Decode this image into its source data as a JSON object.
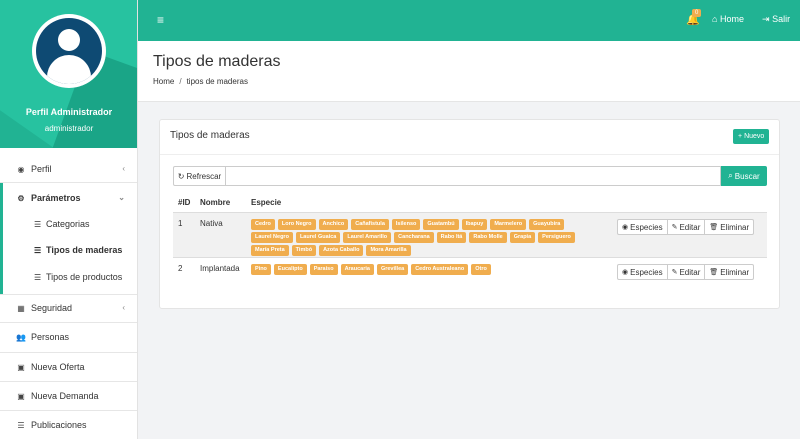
{
  "sidebar": {
    "profile_name": "Perfil Administrador",
    "profile_role": "administrador",
    "items": [
      {
        "label": "Perfil",
        "icon": "user-circle-icon"
      },
      {
        "label": "Parámetros",
        "icon": "cogs-icon"
      },
      {
        "label": "Seguridad",
        "icon": "grid-icon"
      },
      {
        "label": "Personas",
        "icon": "users-icon"
      },
      {
        "label": "Nueva Oferta",
        "icon": "cube-icon"
      },
      {
        "label": "Nueva Demanda",
        "icon": "cube-icon"
      },
      {
        "label": "Publicaciones",
        "icon": "list-icon"
      }
    ],
    "subitems": [
      {
        "label": "Categorias"
      },
      {
        "label": "Tipos de maderas"
      },
      {
        "label": "Tipos de productos"
      }
    ]
  },
  "topbar": {
    "notification_count": "0",
    "home_label": "Home",
    "exit_label": "Salir"
  },
  "page": {
    "title": "Tipos de maderas",
    "breadcrumb_home": "Home",
    "breadcrumb_current": "tipos de maderas"
  },
  "card": {
    "title": "Tipos de maderas",
    "new_button": "Nuevo",
    "refresh_button": "Refrescar",
    "search_button": "Buscar",
    "search_value": ""
  },
  "table": {
    "headers": [
      "#ID",
      "Nombre",
      "Especie"
    ],
    "actions": [
      "Especies",
      "Editar",
      "Eliminar"
    ],
    "rows": [
      {
        "id": "1",
        "name": "Nativa",
        "species": [
          "Cedro",
          "Loro Negro",
          "Anchico",
          "Cañafistula",
          "Isilenso",
          "Guatambú",
          "Ibapuy",
          "Marmelero",
          "Guayubira",
          "Laurel Negro",
          "Laurel Guaica",
          "Laurel Amarillo",
          "Cancharana",
          "Rabo Itá",
          "Rabo Molle",
          "Grapia",
          "Persiguero",
          "María Preta",
          "Timbó",
          "Azota Caballo",
          "Mora Amarilla"
        ]
      },
      {
        "id": "2",
        "name": "Implantada",
        "species": [
          "Pino",
          "Eucalipto",
          "Paraiso",
          "Araucaria",
          "Grevillea",
          "Cedro Australeano",
          "Otro"
        ]
      }
    ]
  },
  "colors": {
    "accent": "#21b393",
    "tag": "#f0ad4e",
    "avatar": "#0e4a73"
  }
}
